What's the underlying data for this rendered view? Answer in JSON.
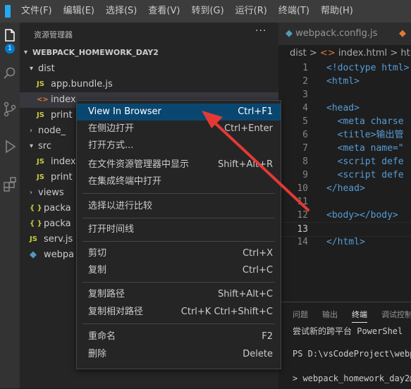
{
  "menubar": {
    "items": [
      "文件(F)",
      "编辑(E)",
      "选择(S)",
      "查看(V)",
      "转到(G)",
      "运行(R)",
      "终端(T)",
      "帮助(H)"
    ]
  },
  "activitybar": {
    "badge": "1"
  },
  "sidebar": {
    "title": "资源管理器",
    "more": "···",
    "section": "WEBPACK_HOMEWORK_DAY2",
    "tree": [
      {
        "label": "dist",
        "kind": "folder"
      },
      {
        "label": "app.bundle.js",
        "kind": "js",
        "icon_text": "JS"
      },
      {
        "label": "index",
        "kind": "html",
        "icon_text": "<>"
      },
      {
        "label": "print",
        "kind": "js",
        "icon_text": "JS"
      },
      {
        "label": "node_",
        "kind": "folder"
      },
      {
        "label": "src",
        "kind": "folder"
      },
      {
        "label": "index",
        "kind": "js",
        "icon_text": "JS"
      },
      {
        "label": "print",
        "kind": "js",
        "icon_text": "JS"
      },
      {
        "label": "views",
        "kind": "folder"
      },
      {
        "label": "packa",
        "kind": "json",
        "icon_text": "{ }"
      },
      {
        "label": "packa",
        "kind": "json",
        "icon_text": "{ }"
      },
      {
        "label": "serv.js",
        "kind": "js",
        "icon_text": "JS"
      },
      {
        "label": "webpa",
        "kind": "webpack",
        "icon_text": "◆"
      }
    ]
  },
  "editor": {
    "tabs": [
      {
        "label": "webpack.config.js",
        "icon_text": "◆"
      }
    ],
    "breadcrumb": {
      "folder": "dist",
      "sep": ">",
      "icon_text": "<>",
      "file": "index.html",
      "next": "htm"
    },
    "lines": [
      {
        "num": "1",
        "text": "<!doctype html>"
      },
      {
        "num": "2",
        "text": "<html>"
      },
      {
        "num": "3",
        "text": ""
      },
      {
        "num": "4",
        "text": "<head>"
      },
      {
        "num": "5",
        "text": "  <meta charse"
      },
      {
        "num": "6",
        "text": "  <title>输出管"
      },
      {
        "num": "7",
        "text": "  <meta name=\""
      },
      {
        "num": "8",
        "text": "  <script defe"
      },
      {
        "num": "9",
        "text": "  <script defe"
      },
      {
        "num": "10",
        "text": "</head>"
      },
      {
        "num": "11",
        "text": ""
      },
      {
        "num": "12",
        "text": "<body></body>"
      },
      {
        "num": "13",
        "text": ""
      },
      {
        "num": "14",
        "text": "</html>"
      }
    ]
  },
  "panel": {
    "tabs": [
      "问题",
      "输出",
      "终端",
      "调试控制"
    ],
    "active_tab": "终端",
    "lines": [
      "尝试新的跨平台 PowerShel",
      "PS D:\\vsCodeProject\\webp",
      "> webpack_homework_day2@"
    ]
  },
  "context_menu": {
    "items": [
      {
        "label": "View In Browser",
        "shortcut": "Ctrl+F1",
        "highlight": true
      },
      {
        "label": "在侧边打开",
        "shortcut": "Ctrl+Enter"
      },
      {
        "label": "打开方式...",
        "shortcut": ""
      },
      {
        "label": "在文件资源管理器中显示",
        "shortcut": "Shift+Alt+R"
      },
      {
        "label": "在集成终端中打开",
        "shortcut": ""
      },
      {
        "label": "选择以进行比较",
        "shortcut": ""
      },
      {
        "label": "打开时间线",
        "shortcut": ""
      },
      {
        "label": "剪切",
        "shortcut": "Ctrl+X"
      },
      {
        "label": "复制",
        "shortcut": "Ctrl+C"
      },
      {
        "label": "复制路径",
        "shortcut": "Shift+Alt+C"
      },
      {
        "label": "复制相对路径",
        "shortcut": "Ctrl+K Ctrl+Shift+C"
      },
      {
        "label": "重命名",
        "shortcut": "F2"
      },
      {
        "label": "删除",
        "shortcut": "Delete"
      }
    ]
  },
  "colors": {
    "accent": "#007acc",
    "menu_highlight": "#094771",
    "annotation_arrow": "#e53935"
  }
}
